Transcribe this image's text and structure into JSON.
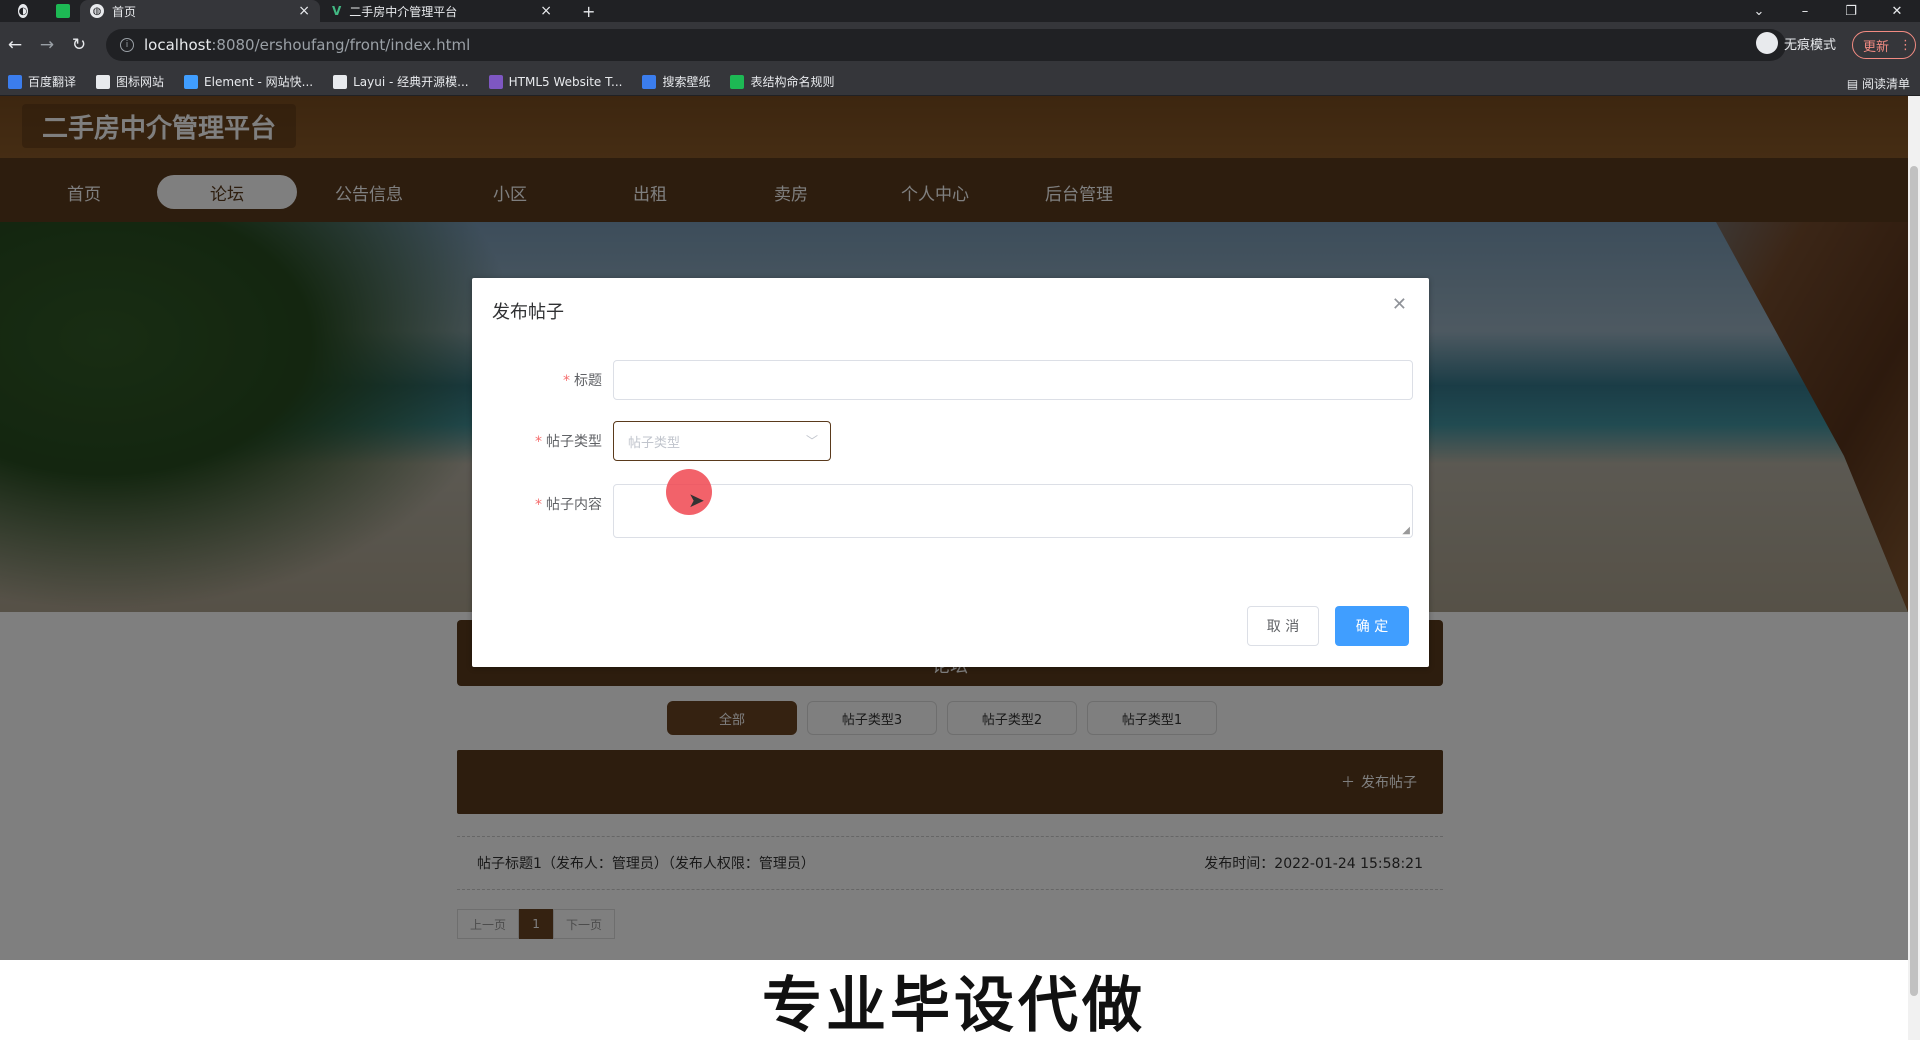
{
  "browser": {
    "tabs": [
      {
        "label": "首页",
        "icon": "globe-icon"
      },
      {
        "label": "二手房中介管理平台",
        "icon": "vue-icon"
      }
    ],
    "new_tab_glyph": "+",
    "url_host": "localhost",
    "url_path": ":8080/ershoufang/front/index.html",
    "incognito_label": "无痕模式",
    "update_label": "更新",
    "bookmarks": [
      {
        "label": "百度翻译",
        "color": "#3b7ded"
      },
      {
        "label": "图标网站",
        "color": "#e8eaed"
      },
      {
        "label": "Element - 网站快...",
        "color": "#409eff"
      },
      {
        "label": "Layui - 经典开源模...",
        "color": "#e8eaed"
      },
      {
        "label": "HTML5 Website T...",
        "color": "#7e57c2"
      },
      {
        "label": "搜索壁纸",
        "color": "#3b7ded"
      },
      {
        "label": "表结构命名规则",
        "color": "#1db954"
      }
    ],
    "reading_list": "阅读清单"
  },
  "site": {
    "title": "二手房中介管理平台",
    "nav": [
      "首页",
      "论坛",
      "公告信息",
      "小区",
      "出租",
      "卖房",
      "个人中心",
      "后台管理"
    ],
    "active_nav": "论坛"
  },
  "forum": {
    "section_title": "论坛",
    "filters": [
      "全部",
      "帖子类型3",
      "帖子类型2",
      "帖子类型1"
    ],
    "post_button": "发布帖子",
    "posts": [
      {
        "title": "帖子标题1（发布人：管理员）（发布人权限：管理员）",
        "time": "发布时间：2022-01-24 15:58:21"
      }
    ],
    "pager": {
      "prev": "上一页",
      "current": "1",
      "next": "下一页"
    }
  },
  "dialog": {
    "title": "发布帖子",
    "fields": {
      "title_label": "标题",
      "type_label": "帖子类型",
      "type_placeholder": "帖子类型",
      "content_label": "帖子内容"
    },
    "cancel": "取 消",
    "confirm": "确 定"
  },
  "watermark": "专业毕设代做",
  "colors": {
    "brand": "#5a3a1c",
    "primary": "#409eff",
    "required": "#f56c6c"
  }
}
